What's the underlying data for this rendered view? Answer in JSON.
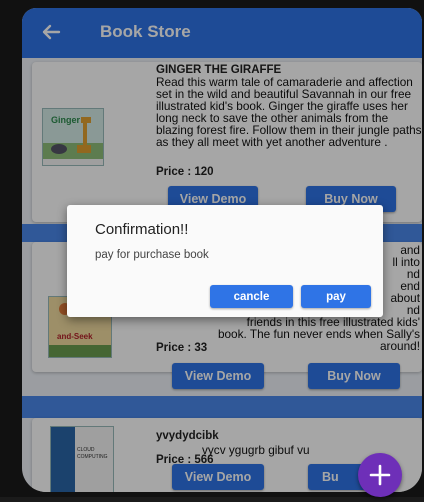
{
  "appbar": {
    "title": "Book Store"
  },
  "books": [
    {
      "title": "GINGER THE GIRAFFE",
      "description": "Read this warm tale of camaraderie and affection set in the wild and beautiful Savannah in our free illustrated kid's book. Ginger the giraffe uses her long neck to save the other animals from the blazing forest fire. Follow them in their jungle paths as they all meet with yet another adventure .",
      "price": "Price : 120",
      "view_demo": "View Demo",
      "buy_now": "Buy Now"
    },
    {
      "description_visible": "and\nll into\nnd\nend\nabout\nnd\nfriends in this free illustrated kids'\nbook. The fun never ends when Sally's\naround!",
      "price": "Price : 33",
      "view_demo": "View Demo",
      "buy_now": "Buy Now"
    },
    {
      "title": "yvydydcibk",
      "description": "vycv ygugrb gibuf vu",
      "price": "Price : 566",
      "view_demo": "View Demo",
      "buy_now": "Bu"
    }
  ],
  "dialog": {
    "title": "Confirmation!!",
    "message": "pay for purchase book",
    "cancel_label": "cancle",
    "pay_label": "pay"
  },
  "fab": {
    "icon": "plus-icon",
    "symbol": "+"
  },
  "colors": {
    "primary": "#2f74e6",
    "fab": "#6e2fb8"
  }
}
